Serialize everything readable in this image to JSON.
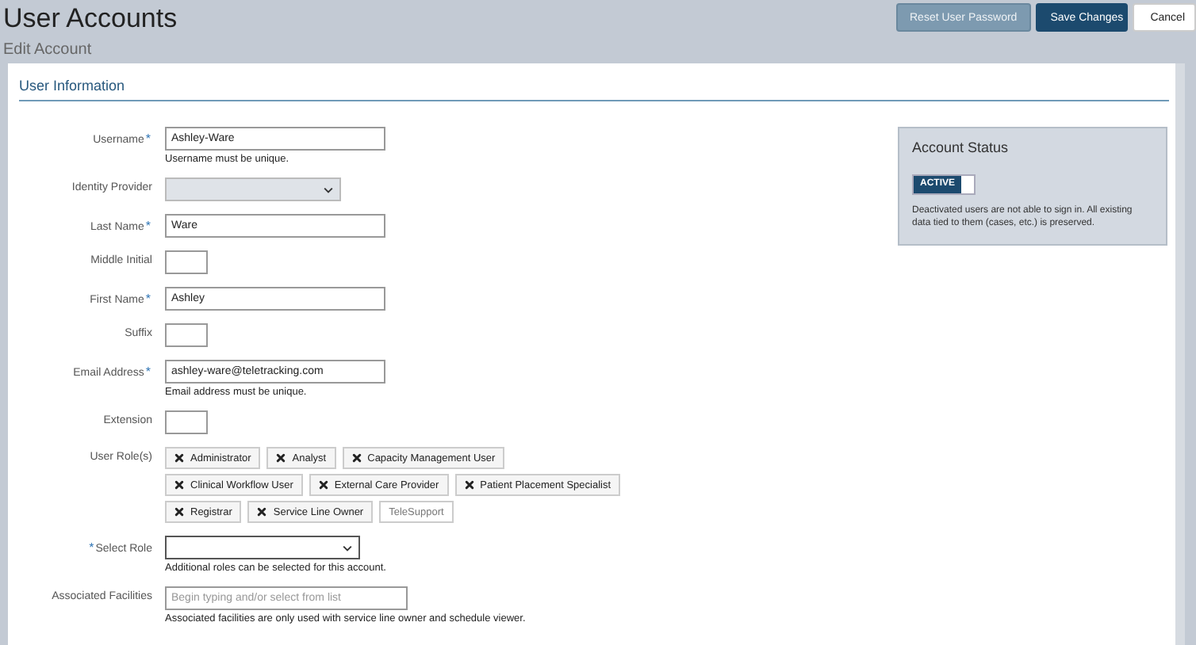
{
  "header": {
    "title": "User Accounts",
    "subtitle": "Edit Account",
    "buttons": [
      {
        "label": "Reset User Password",
        "kind": "secondary"
      },
      {
        "label": "Save Changes",
        "kind": "primary"
      },
      {
        "label": "Cancel",
        "kind": "plain"
      }
    ]
  },
  "section": {
    "title": "User Information"
  },
  "fields": [
    {
      "label": "Username",
      "required_mark": "*",
      "mark_first": false,
      "kind": "text",
      "value": "Ashley-Ware",
      "help": "Username must be unique."
    },
    {
      "label": "Identity Provider",
      "kind": "select",
      "disabled": true
    },
    {
      "label": "Last Name",
      "required_mark": "*",
      "mark_first": false,
      "kind": "text",
      "value": "Ware"
    },
    {
      "label": "Middle Initial",
      "kind": "short"
    },
    {
      "label": "First Name",
      "required_mark": "*",
      "mark_first": false,
      "kind": "text",
      "value": "Ashley"
    },
    {
      "label": "Suffix",
      "kind": "short"
    },
    {
      "label": "Email Address",
      "required_mark": "*",
      "mark_first": false,
      "kind": "text",
      "value": "ashley-ware@teletracking.com",
      "help": "Email address must be unique."
    },
    {
      "label": "Extension",
      "kind": "short"
    },
    {
      "label": "User Role(s)",
      "kind": "tags",
      "tags": [
        {
          "label": "Administrator",
          "removable": true
        },
        {
          "label": "Analyst",
          "removable": true
        },
        {
          "label": "Capacity Management User",
          "removable": true
        },
        {
          "label": "Clinical Workflow User",
          "removable": true
        },
        {
          "label": "External Care Provider",
          "removable": true
        },
        {
          "label": "Patient Placement Specialist",
          "removable": true
        },
        {
          "label": "Registrar",
          "removable": true
        },
        {
          "label": "Service Line Owner",
          "removable": true
        },
        {
          "label": "TeleSupport",
          "removable": false
        }
      ]
    },
    {
      "label": "Select Role",
      "required_mark": "*",
      "mark_first": true,
      "kind": "select",
      "disabled": false,
      "help": "Additional roles can be selected for this account."
    },
    {
      "label": "Associated Facilities",
      "kind": "search",
      "placeholder": "Begin typing and/or select from list",
      "help": "Associated facilities are only used with service line owner and schedule viewer."
    }
  ],
  "account_status": {
    "title": "Account Status",
    "toggle": {
      "label": "ACTIVE",
      "on": true
    },
    "note": "Deactivated users are not able to sign in. All existing data tied to them (cases, etc.) is preserved."
  }
}
